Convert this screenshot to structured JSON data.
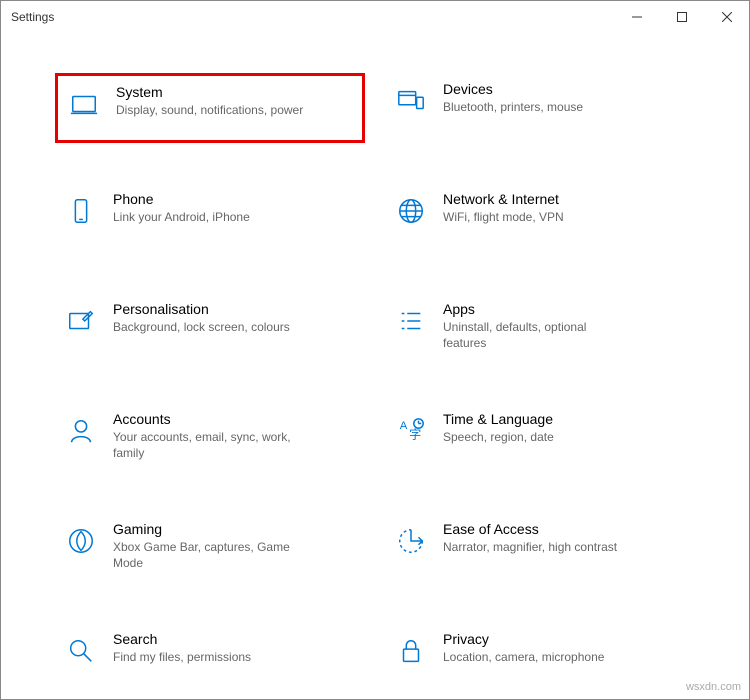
{
  "window": {
    "title": "Settings"
  },
  "tiles": [
    {
      "id": "system",
      "title": "System",
      "desc": "Display, sound, notifications, power",
      "highlight": true
    },
    {
      "id": "devices",
      "title": "Devices",
      "desc": "Bluetooth, printers, mouse",
      "highlight": false
    },
    {
      "id": "phone",
      "title": "Phone",
      "desc": "Link your Android, iPhone",
      "highlight": false
    },
    {
      "id": "network",
      "title": "Network & Internet",
      "desc": "WiFi, flight mode, VPN",
      "highlight": false
    },
    {
      "id": "personalisation",
      "title": "Personalisation",
      "desc": "Background, lock screen, colours",
      "highlight": false
    },
    {
      "id": "apps",
      "title": "Apps",
      "desc": "Uninstall, defaults, optional features",
      "highlight": false
    },
    {
      "id": "accounts",
      "title": "Accounts",
      "desc": "Your accounts, email, sync, work, family",
      "highlight": false
    },
    {
      "id": "time-language",
      "title": "Time & Language",
      "desc": "Speech, region, date",
      "highlight": false
    },
    {
      "id": "gaming",
      "title": "Gaming",
      "desc": "Xbox Game Bar, captures, Game Mode",
      "highlight": false
    },
    {
      "id": "ease-of-access",
      "title": "Ease of Access",
      "desc": "Narrator, magnifier, high contrast",
      "highlight": false
    },
    {
      "id": "search",
      "title": "Search",
      "desc": "Find my files, permissions",
      "highlight": false
    },
    {
      "id": "privacy",
      "title": "Privacy",
      "desc": "Location, camera, microphone",
      "highlight": false
    }
  ],
  "watermark": "wsxdn.com"
}
